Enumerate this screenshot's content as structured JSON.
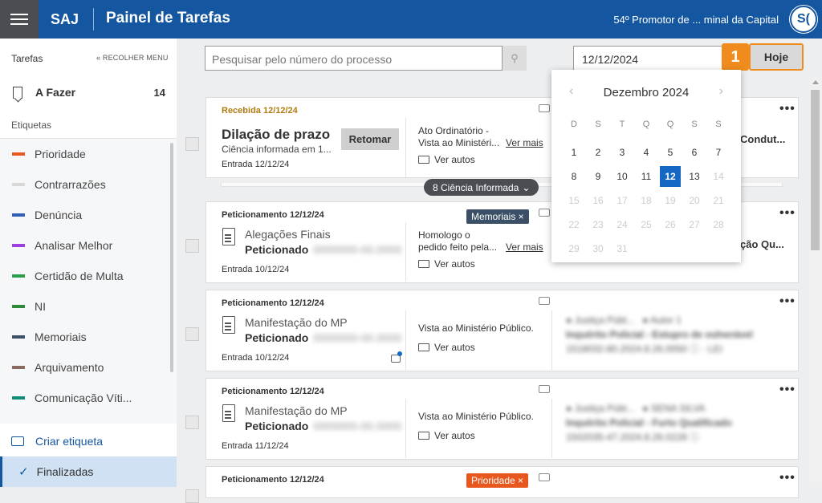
{
  "header": {
    "brand": "SAJ",
    "title": "Painel de Tarefas",
    "user": "54º Promotor de ... minal da Capital",
    "avatar": "S("
  },
  "sidebar": {
    "heading": "Tarefas",
    "collapse": "« RECOLHER MENU",
    "todo": {
      "label": "A Fazer",
      "count": "14"
    },
    "etiquetas_label": "Etiquetas",
    "items": [
      {
        "label": "Prioridade",
        "color": "#e8571e"
      },
      {
        "label": "Contrarrazões",
        "color": "#d8d8d8"
      },
      {
        "label": "Denúncia",
        "color": "#2f5fb5"
      },
      {
        "label": "Analisar Melhor",
        "color": "#9b3fe0"
      },
      {
        "label": "Certidão de Multa",
        "color": "#2c9e4b"
      },
      {
        "label": "NI",
        "color": "#2e8b3a"
      },
      {
        "label": "Memoriais",
        "color": "#3b5066"
      },
      {
        "label": "Arquivamento",
        "color": "#8b6b60"
      },
      {
        "label": "Comunicação Víti...",
        "color": "#128a7a"
      }
    ],
    "create": "Criar etiqueta",
    "finalized": "Finalizadas"
  },
  "toolbar": {
    "search_placeholder": "Pesquisar pelo número do processo",
    "date": "12/12/2024",
    "step": "1",
    "today": "Hoje"
  },
  "calendar": {
    "month": "Dezembro 2024",
    "weekdays": [
      "D",
      "S",
      "T",
      "Q",
      "Q",
      "S",
      "S"
    ],
    "days": [
      "1",
      "2",
      "3",
      "4",
      "5",
      "6",
      "7",
      "8",
      "9",
      "10",
      "11",
      "12",
      "13",
      "14",
      "15",
      "16",
      "17",
      "18",
      "19",
      "20",
      "21",
      "22",
      "23",
      "24",
      "25",
      "26",
      "27",
      "28",
      "29",
      "30",
      "31"
    ],
    "selected": "12"
  },
  "cards": [
    {
      "kind": "Recebida 12/12/24",
      "title": "Dilação de prazo",
      "subtitle": "Ciência informada em 1...",
      "button": "Retomar",
      "desc1": "Ato Ordinatório -",
      "desc2": "Vista ao Ministéri...",
      "more": "Ver mais",
      "autos": "Ver autos",
      "entry": "Entrada 12/12/24",
      "right": "Condut..."
    },
    {
      "kind": "Peticionamento 12/12/24",
      "title": "Alegações Finais",
      "subtitle": "Peticionado",
      "desc1": "Homologo o",
      "desc2": "pedido feito pela...",
      "more": "Ver mais",
      "autos": "Ver autos",
      "entry": "Entrada 10/12/24",
      "chip": "Memoriais ×",
      "right": "ção Qu..."
    },
    {
      "kind": "Peticionamento 12/12/24",
      "title": "Manifestação do MP",
      "subtitle": "Peticionado",
      "desc1": "Vista ao Ministério Público.",
      "autos": "Ver autos",
      "entry": "Entrada 10/12/24"
    },
    {
      "kind": "Peticionamento 12/12/24",
      "title": "Manifestação do MP",
      "subtitle": "Peticionado",
      "desc1": "Vista ao Ministério Público.",
      "autos": "Ver autos",
      "entry": "Entrada 11/12/24"
    },
    {
      "kind": "Peticionamento 12/12/24",
      "chip": "Prioridade ×"
    }
  ],
  "group_badge": "8 Ciência Informada"
}
